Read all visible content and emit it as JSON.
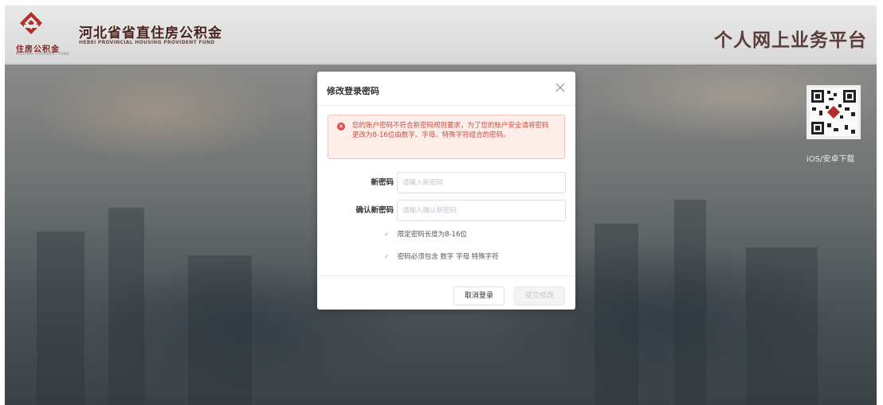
{
  "header": {
    "logo_sub": "住房公积金",
    "logo_tiny": "HOUSING PROVIDENT FUND",
    "org_name": "河北省省直住房公积金",
    "org_name_en": "HEBEI PROVINCIAL HOUSING PROVIDENT FUND",
    "platform_title": "个人网上业务平台",
    "brand_color": "#8a1f1f"
  },
  "qr": {
    "label": "iOS/安卓下载",
    "icon": "qr-code-icon"
  },
  "modal": {
    "title": "修改登录密码",
    "close_icon": "close-icon",
    "alert": {
      "icon": "error-icon",
      "text": "您的账户密码不符合新密码规则要求，为了您的账户安全请将密码更改为8-16位由数字、字母、特殊字符组合的密码。",
      "color": "#d24a3c"
    },
    "fields": {
      "new_password": {
        "label": "新密码",
        "value": "",
        "placeholder": "请输入新密码"
      },
      "confirm_password": {
        "label": "确认新密码",
        "value": "",
        "placeholder": "请输入确认新密码"
      }
    },
    "rules": [
      {
        "icon": "check-icon",
        "text": "限定密码长度为8-16位"
      },
      {
        "icon": "check-icon",
        "text": "密码必须包含 数字 字母 特殊字符"
      }
    ],
    "buttons": {
      "cancel": "取消登录",
      "submit": "提交修改"
    }
  }
}
